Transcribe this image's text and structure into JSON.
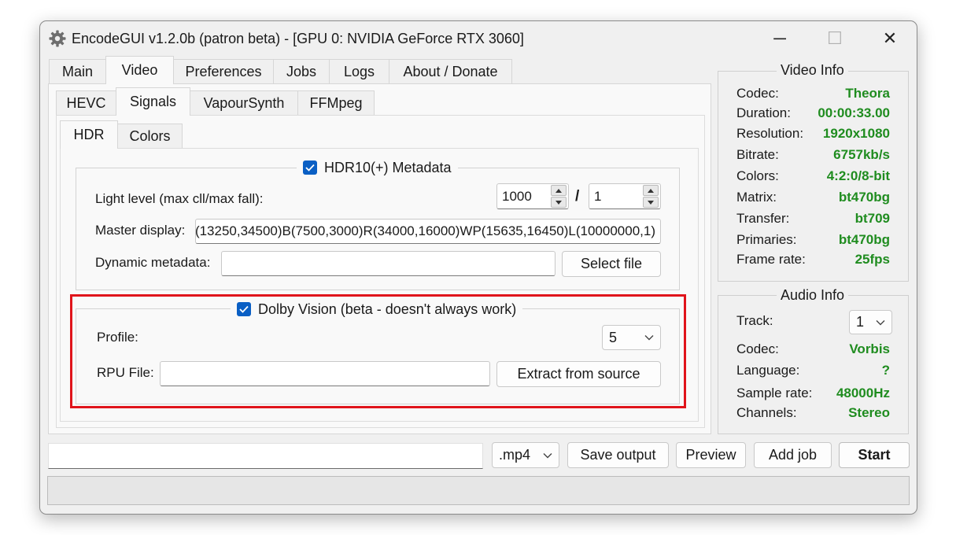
{
  "window": {
    "title": "EncodeGUI v1.2.0b (patron beta) - [GPU 0: NVIDIA GeForce RTX 3060]",
    "minimize_glyph": "─",
    "maximize_glyph": "☐",
    "close_glyph": "✕"
  },
  "main_tabs": [
    "Main",
    "Video",
    "Preferences",
    "Jobs",
    "Logs",
    "About / Donate"
  ],
  "sub_tabs": [
    "HEVC",
    "Signals",
    "VapourSynth",
    "FFMpeg"
  ],
  "inner_tabs": [
    "HDR",
    "Colors"
  ],
  "hdr": {
    "legend": "HDR10(+) Metadata",
    "checked": true,
    "light_level_label": "Light level (max cll/max fall):",
    "max_cll": "1000",
    "separator": "/",
    "max_fall": "1",
    "master_display_label": "Master display:",
    "master_display_value": "(13250,34500)B(7500,3000)R(34000,16000)WP(15635,16450)L(10000000,1)",
    "dynamic_metadata_label": "Dynamic metadata:",
    "dynamic_metadata_value": "",
    "select_file_label": "Select file"
  },
  "dolby": {
    "legend": "Dolby Vision (beta - doesn't always work)",
    "checked": true,
    "profile_label": "Profile:",
    "profile_value": "5",
    "rpu_label": "RPU File:",
    "rpu_value": "",
    "extract_label": "Extract from source",
    "highlight_color": "#e0141b"
  },
  "video_info": {
    "title": "Video Info",
    "rows": [
      {
        "key": "Codec:",
        "value": "Theora"
      },
      {
        "key": "Duration:",
        "value": "00:00:33.00"
      },
      {
        "key": "Resolution:",
        "value": "1920x1080"
      },
      {
        "key": "Bitrate:",
        "value": "6757kb/s"
      },
      {
        "key": "Colors:",
        "value": "4:2:0/8-bit"
      },
      {
        "key": "Matrix:",
        "value": "bt470bg"
      },
      {
        "key": "Transfer:",
        "value": "bt709"
      },
      {
        "key": "Primaries:",
        "value": "bt470bg"
      },
      {
        "key": "Frame rate:",
        "value": "25fps"
      }
    ]
  },
  "audio_info": {
    "title": "Audio Info",
    "track_label": "Track:",
    "track_value": "1",
    "rows": [
      {
        "key": "Codec:",
        "value": "Vorbis"
      },
      {
        "key": "Language:",
        "value": "?"
      },
      {
        "key": "Sample rate:",
        "value": "48000Hz"
      },
      {
        "key": "Channels:",
        "value": "Stereo"
      }
    ]
  },
  "bottom": {
    "output_path": "",
    "container": ".mp4",
    "save_output": "Save output",
    "preview": "Preview",
    "add_job": "Add job",
    "start": "Start"
  },
  "colors": {
    "value_green": "#1f8c1f",
    "checkbox_blue": "#0a5fc4"
  }
}
